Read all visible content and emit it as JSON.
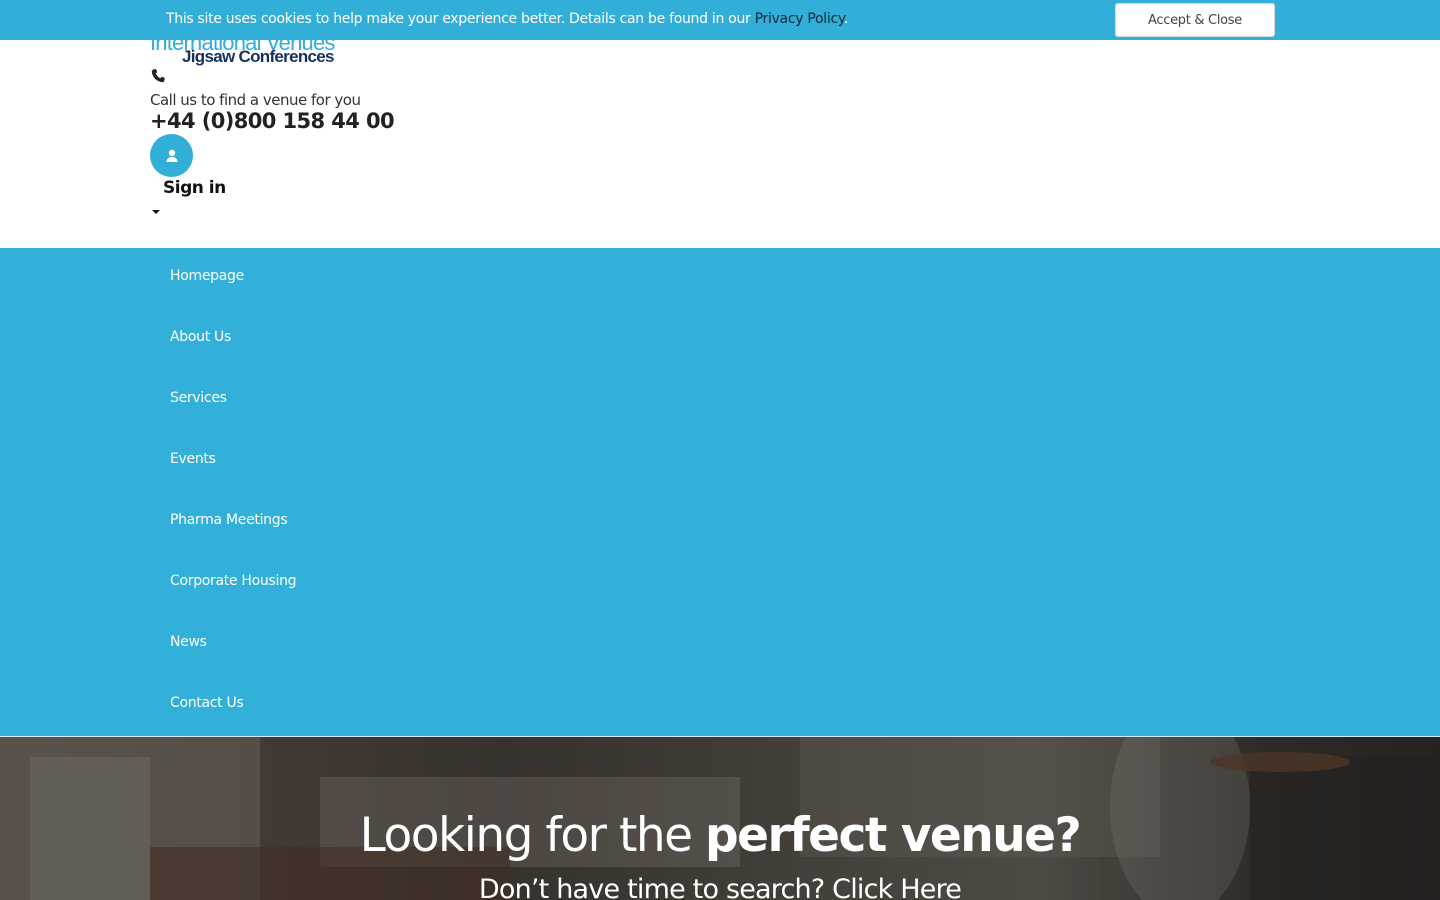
{
  "cookie_bar": {
    "text": "This site uses cookies to help make your experience better. Details can be found in our ",
    "link_text": "Privacy Policy",
    "after_link": ".",
    "accept_label": "Accept & Close"
  },
  "header": {
    "logo_top": "International Venues",
    "logo_bottom": "Jigsaw Conferences",
    "call_text": "Call us to find a venue for you",
    "phone": "+44 (0)800 158 44 00",
    "sign_in": "Sign in"
  },
  "nav": {
    "items": [
      {
        "label": "Homepage"
      },
      {
        "label": "About Us"
      },
      {
        "label": "Services"
      },
      {
        "label": "Events"
      },
      {
        "label": "Pharma Meetings"
      },
      {
        "label": "Corporate Housing"
      },
      {
        "label": "News"
      },
      {
        "label": "Contact Us"
      }
    ]
  },
  "hero": {
    "title_light": "Looking for the ",
    "title_bold": "perfect venue?",
    "subtitle": "Don’t have time to search? Click Here"
  },
  "colors": {
    "accent": "#31afd8",
    "brand_dark": "#16305f"
  }
}
